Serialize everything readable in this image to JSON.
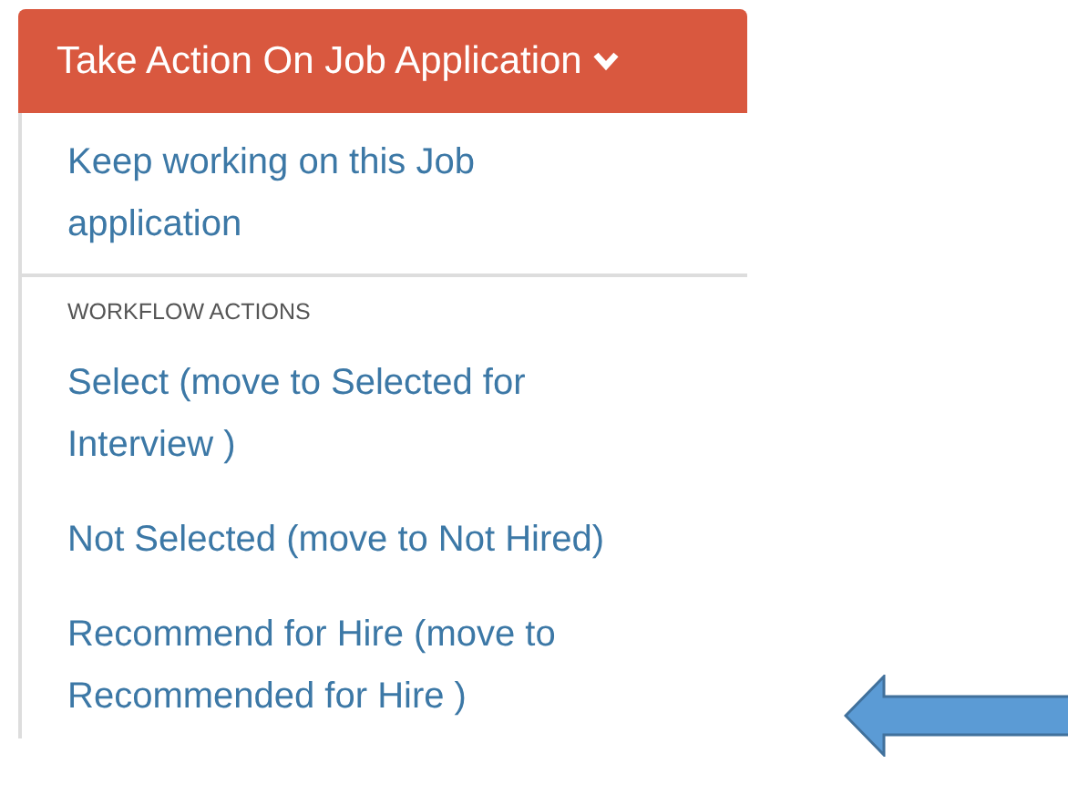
{
  "button": {
    "label": "Take Action On Job Application",
    "expanded": true
  },
  "menu": {
    "items": [
      {
        "label": "Keep working on this Job application"
      }
    ],
    "section_header": "WORKFLOW ACTIONS",
    "workflow_items": [
      {
        "label": "Select (move to Selected for Interview )"
      },
      {
        "label": "Not Selected (move to Not Hired)"
      },
      {
        "label": "Recommend for Hire (move to Recommended for Hire )"
      }
    ]
  }
}
